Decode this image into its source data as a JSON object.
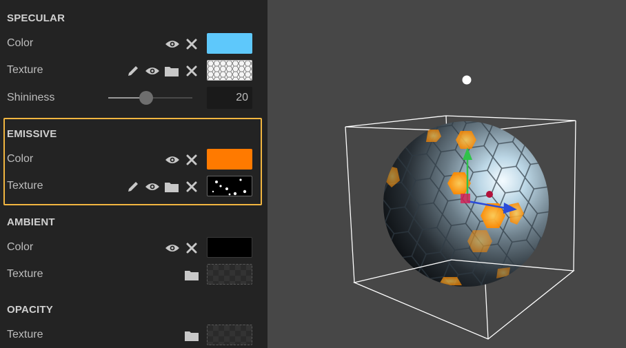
{
  "specular": {
    "title": "SPECULAR",
    "color_label": "Color",
    "color_value": "#5ec8fb",
    "texture_label": "Texture",
    "shininess_label": "Shininess",
    "shininess_value": "20",
    "shininess_fraction": 0.45
  },
  "emissive": {
    "title": "EMISSIVE",
    "color_label": "Color",
    "color_value": "#ff7a00",
    "texture_label": "Texture"
  },
  "ambient": {
    "title": "AMBIENT",
    "color_label": "Color",
    "color_value": "#000000",
    "texture_label": "Texture"
  },
  "opacity": {
    "title": "OPACITY",
    "texture_label": "Texture"
  },
  "icons": [
    "eye-icon",
    "close-icon",
    "pencil-icon",
    "folder-icon"
  ],
  "colors": {
    "panel_bg": "#232323",
    "viewport_bg": "#474747",
    "highlight_border": "#f2b640",
    "gizmo_x": "#2a4bd8",
    "gizmo_y": "#2fc24a",
    "gizmo_center": "#b2103a"
  }
}
